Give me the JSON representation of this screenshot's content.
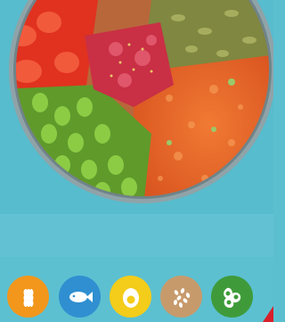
{
  "image": {
    "subject": "poke-bowl",
    "colors": {
      "background": "#5bbfd0",
      "bowl_rim": "#8fa3a8",
      "edamame": "#7fbf3a",
      "carrot": "#e8642a",
      "tomato": "#e0321f",
      "tuna": "#d23a4a",
      "seeds": "#8a8a45"
    }
  },
  "icon_bar": {
    "items": [
      {
        "name": "grain-icon",
        "color": "#f2961c"
      },
      {
        "name": "fish-icon",
        "color": "#2f8fd0"
      },
      {
        "name": "egg-icon",
        "color": "#f4cc1a"
      },
      {
        "name": "sesame-icon",
        "color": "#c79a6c"
      },
      {
        "name": "soy-icon",
        "color": "#3f9b3a"
      }
    ]
  }
}
